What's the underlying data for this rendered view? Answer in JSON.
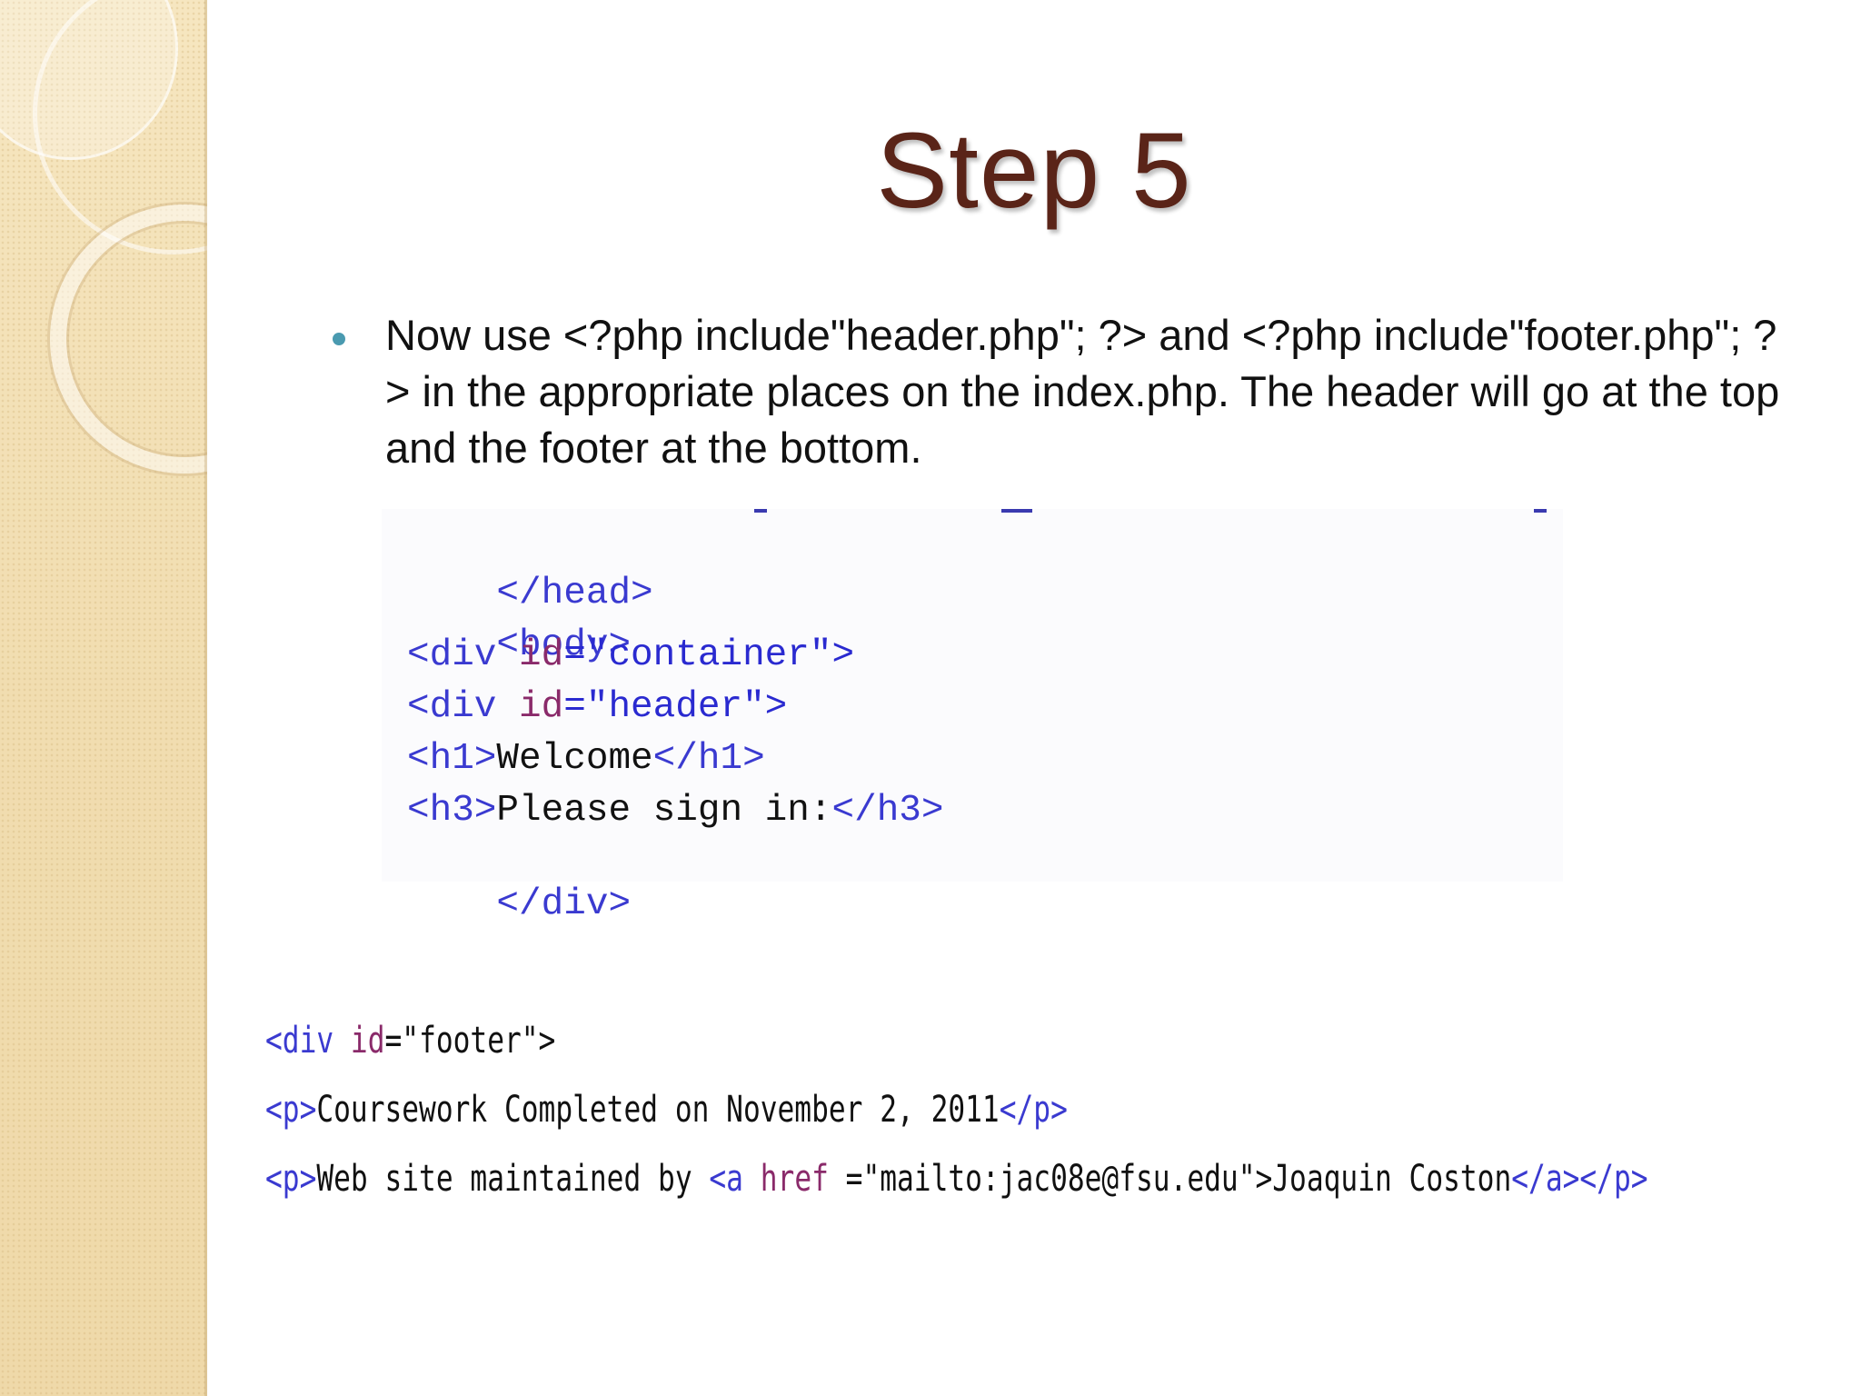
{
  "slide": {
    "title": "Step 5",
    "bullet": "Now use <?php include\"header.php\"; ?> and <?php include\"footer.php\"; ?> in the appropriate places on the index.php. The header will go at the top and the footer at the bottom."
  },
  "code_top": {
    "l1": {
      "t": "</head>"
    },
    "l2": {
      "t": "<body>"
    },
    "l3": {
      "a": "<div ",
      "b": "id",
      "c": "=\"container\">"
    },
    "l4": {
      "a": "<div ",
      "b": "id",
      "c": "=\"header\">"
    },
    "l5": {
      "a": "<h1>",
      "b": "Welcome",
      "c": "</h1>"
    },
    "l6": {
      "a": "<h3>",
      "b": "Please sign in:",
      "c": "</h3>"
    },
    "l7": {
      "t": "</div>"
    }
  },
  "code_bottom": {
    "l1": {
      "a": "<div ",
      "b": "id",
      "c": "=\"footer\">"
    },
    "l2": {
      "a": "<p>",
      "b": "Coursework Completed on November 2, 2011",
      "c": "</p>"
    },
    "l3": {
      "a": "<p>",
      "b": "Web site maintained by ",
      "c": "<a ",
      "d": "href",
      "e": " =\"mailto:jac08e@fsu.edu\">",
      "f": "Joaquin Coston",
      "g": "</a></p>"
    }
  },
  "colors": {
    "title": "#5a2418",
    "bullet": "#4a9ab0",
    "code_tag": "#3a3ad0",
    "code_attr": "#8a2a6a",
    "side_band": "#f3e2b8"
  }
}
